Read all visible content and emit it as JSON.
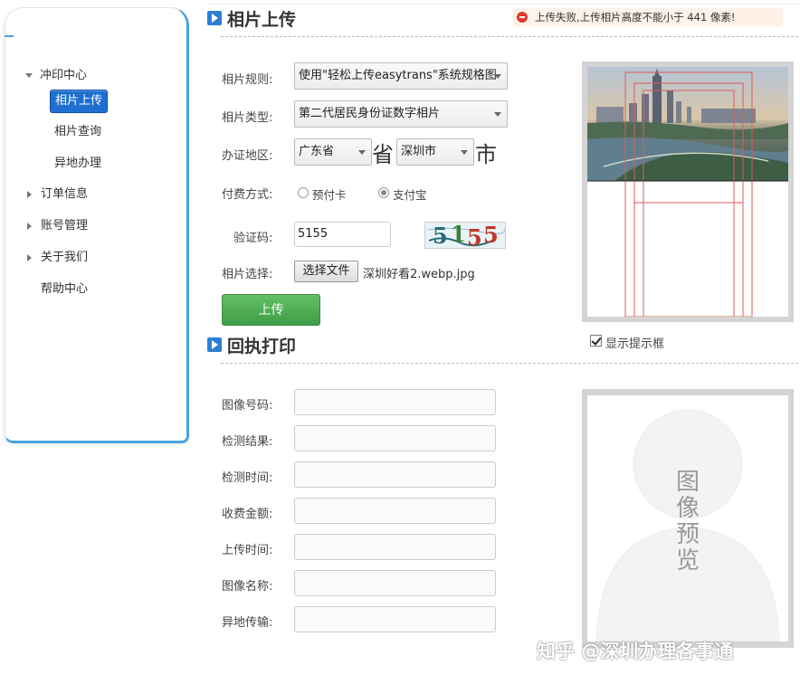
{
  "alert": {
    "text": "上传失败,上传相片高度不能小于 441 像素!"
  },
  "sidebar": {
    "items": [
      {
        "label": "冲印中心",
        "expanded": true
      },
      {
        "label": "相片上传",
        "active": true
      },
      {
        "label": "相片查询"
      },
      {
        "label": "异地办理"
      },
      {
        "label": "订单信息"
      },
      {
        "label": "账号管理"
      },
      {
        "label": "关于我们"
      },
      {
        "label": "帮助中心"
      }
    ]
  },
  "upload": {
    "title": "相片上传",
    "rule_label": "相片规则:",
    "rule_value": "使用\"轻松上传easytrans\"系统规格图",
    "type_label": "相片类型:",
    "type_value": "第二代居民身份证数字相片",
    "region_label": "办证地区:",
    "province_value": "广东省",
    "province_suffix": "省",
    "city_value": "深圳市",
    "city_suffix": "市",
    "pay_label": "付费方式:",
    "pay_options": [
      "预付卡",
      "支付宝"
    ],
    "pay_selected": "支付宝",
    "captcha_label": "验证码:",
    "captcha_value": "5155",
    "captcha_image_text": "5155",
    "file_label": "相片选择:",
    "file_button": "选择文件",
    "file_name": "深圳好看2.webp.jpg",
    "submit_label": "上传",
    "show_guide_label": "显示提示框",
    "show_guide_checked": true
  },
  "receipt": {
    "title": "回执打印",
    "fields": [
      {
        "label": "图像号码:",
        "value": ""
      },
      {
        "label": "检测结果:",
        "value": ""
      },
      {
        "label": "检测时间:",
        "value": ""
      },
      {
        "label": "收费金额:",
        "value": ""
      },
      {
        "label": "上传时间:",
        "value": ""
      },
      {
        "label": "图像名称:",
        "value": ""
      },
      {
        "label": "异地传输:",
        "value": ""
      }
    ],
    "preview_text": "图像预览"
  },
  "watermark": "知乎 @深圳办理各事通",
  "colors": {
    "accent": "#2c7fd3",
    "active_nav": "#1e6fd0",
    "upload_button": "#4caf50",
    "guide_lines": "#e05a5a"
  }
}
